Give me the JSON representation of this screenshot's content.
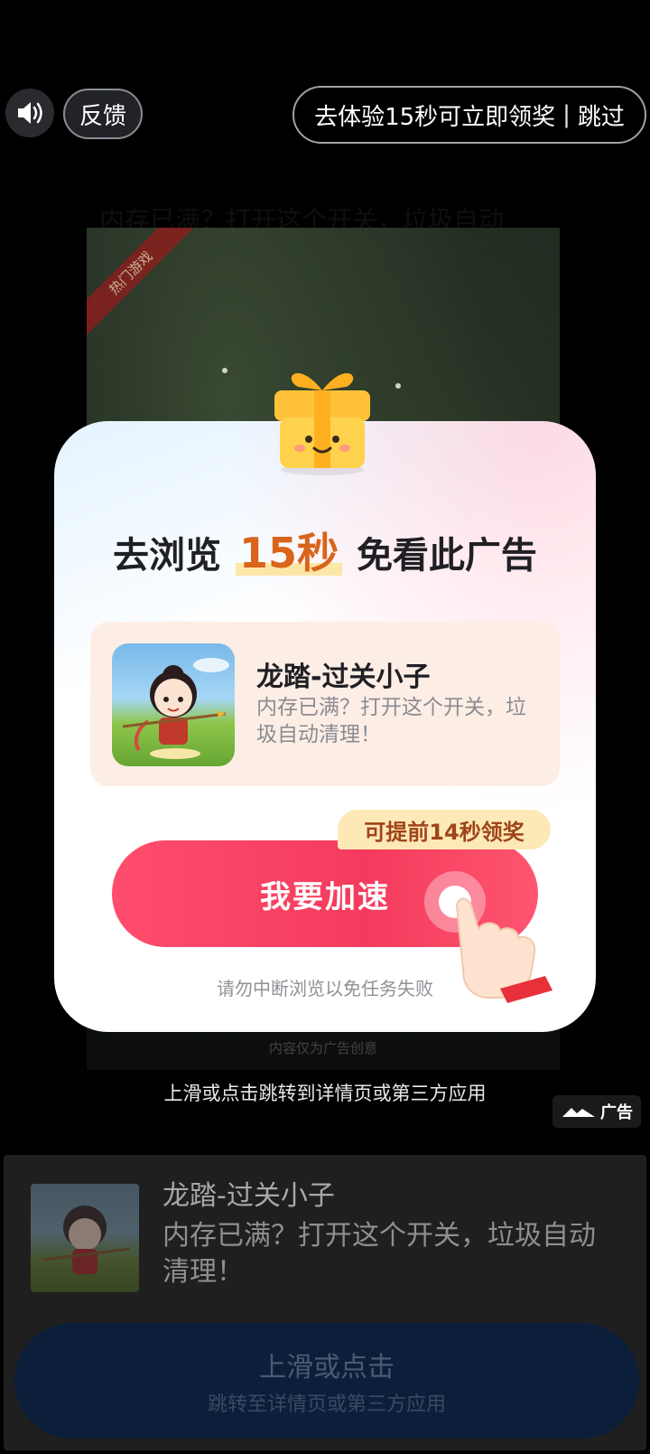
{
  "topbar": {
    "sound_icon": "speaker-icon",
    "feedback_label": "反馈",
    "skip_label_main": "去体验15秒可立即领奖",
    "skip_sep": "|",
    "skip_label_skip": "跳过"
  },
  "background": {
    "headline": "内存已满？打开这个开关，垃圾自动",
    "hot_tag": "热门游戏",
    "creative_note": "内容仅为广告创意"
  },
  "modal": {
    "title_pre": "去浏览",
    "title_num": "15秒",
    "title_post": "免看此广告",
    "app_name": "龙踏-过关小子",
    "app_desc": "内存已满？打开这个开关，垃圾自动清理！",
    "early_badge": "可提前14秒领奖",
    "speed_button": "我要加速",
    "warning": "请勿中断浏览以免任务失败"
  },
  "swipe_hint": "上滑或点击跳转到详情页或第三方应用",
  "ad_badge": "广告",
  "bottom_panel": {
    "title": "龙踏-过关小子",
    "desc": "内存已满？打开这个开关，垃圾自动清理！",
    "cta_main": "上滑或点击",
    "cta_sub": "跳转至详情页或第三方应用"
  },
  "colors": {
    "accent_red": "#f43b5d",
    "title_orange": "#d9641a",
    "badge_yellow": "#fde9b6",
    "cta_navy": "#0b1f3b"
  }
}
